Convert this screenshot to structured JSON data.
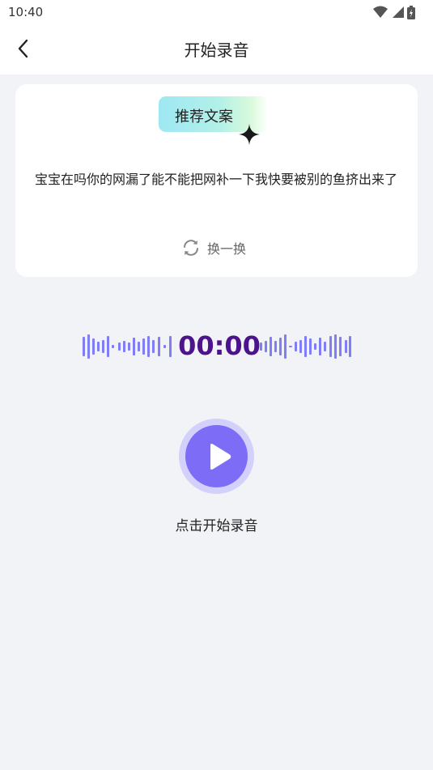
{
  "status_bar": {
    "time": "10:40"
  },
  "header": {
    "title": "开始录音"
  },
  "card": {
    "tag_label": "推荐文案",
    "text": "宝宝在吗你的网漏了能不能把网补一下我快要被别的鱼挤出来了",
    "refresh_label": "换一换"
  },
  "recorder": {
    "timer": "00:00",
    "start_label": "点击开始录音"
  },
  "colors": {
    "accent": "#7c6cf6",
    "accent_light": "#d3d0fb",
    "timer": "#4c138d",
    "wave": "#7f7ef5"
  },
  "icons": [
    "back-arrow-icon",
    "wifi-icon",
    "signal-icon",
    "battery-icon",
    "sparkle-icon",
    "refresh-icon",
    "play-icon"
  ]
}
